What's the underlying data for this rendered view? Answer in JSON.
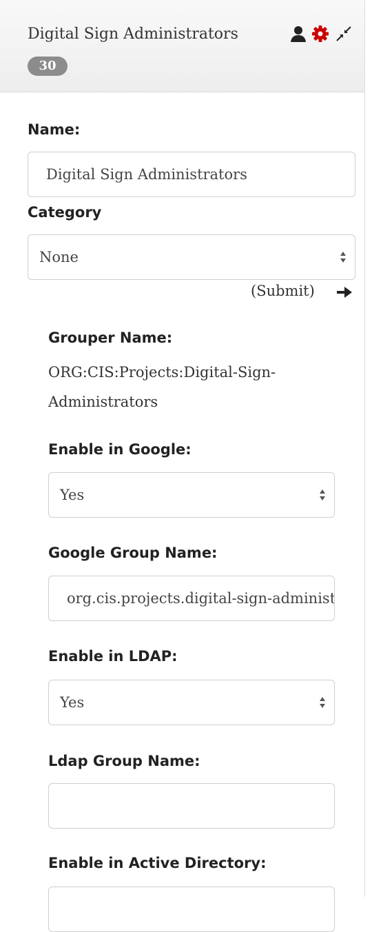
{
  "header": {
    "title": "Digital Sign Administrators",
    "member_count": "30",
    "icons": [
      "user-icon",
      "gear-icon",
      "compress-icon"
    ],
    "gear_color": "#cc0000"
  },
  "form": {
    "name_label": "Name:",
    "name_value": "Digital Sign Administrators",
    "category_label": "Category",
    "category_value": "None",
    "submit_label": "(Submit)",
    "grouper_label": "Grouper Name:",
    "grouper_line1": "ORG:CIS:Projects:Digital-Sign-",
    "grouper_line2": "Administrators",
    "google_enable_label": "Enable in Google:",
    "google_enable_value": "Yes",
    "google_group_label": "Google Group Name:",
    "google_group_value": "org.cis.projects.digital-sign-administrators",
    "ldap_enable_label": "Enable in LDAP:",
    "ldap_enable_value": "Yes",
    "ldap_group_label": "Ldap Group Name:",
    "ldap_group_value": "",
    "ad_enable_label": "Enable in Active Directory:"
  }
}
